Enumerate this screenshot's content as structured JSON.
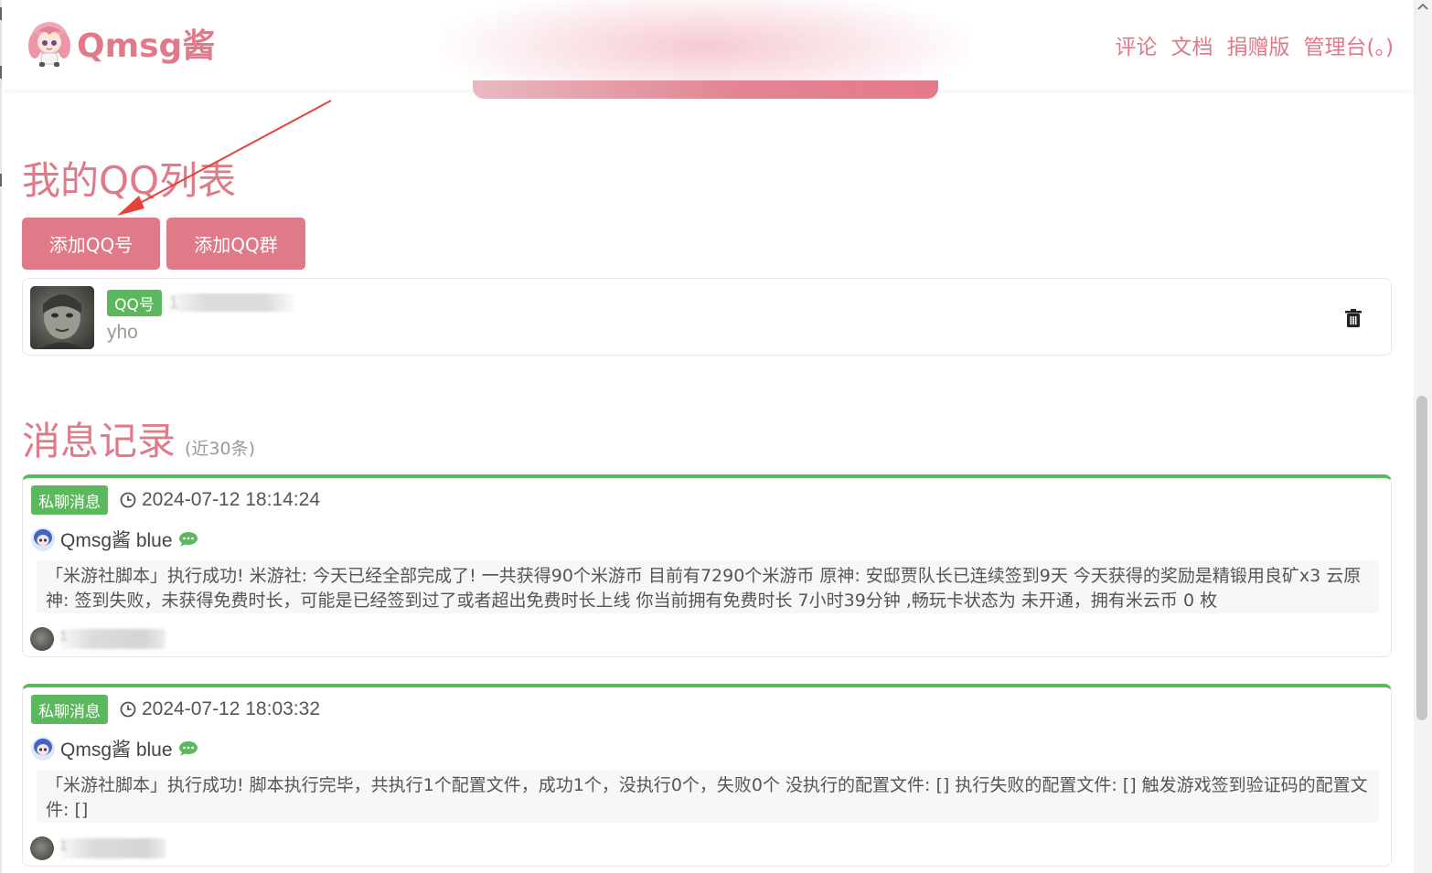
{
  "header": {
    "brand": "Qmsg酱",
    "nav": [
      "评论",
      "文档",
      "捐赠版",
      "管理台(。)"
    ]
  },
  "qq_list": {
    "title": "我的QQ列表",
    "buttons": {
      "add_qq": "添加QQ号",
      "add_group": "添加QQ群"
    },
    "items": [
      {
        "type_tag": "QQ号",
        "number_masked": "1",
        "nickname": "yho"
      }
    ]
  },
  "messages": {
    "title": "消息记录",
    "subtitle": "(近30条)",
    "items": [
      {
        "tag": "私聊消息",
        "time": "2024-07-12 18:14:24",
        "sender": "Qmsg酱 blue",
        "body": "「米游社脚本」执行成功! 米游社: 今天已经全部完成了!   一共获得90个米游币 目前有7290个米游币 原神: 安邸贾队长已连续签到9天 今天获得的奖励是精锻用良矿x3 云原神: 签到失败，未获得免费时长，可能是已经签到过了或者超出免费时长上线 你当前拥有免费时长 7小时39分钟 ,畅玩卡状态为 未开通，拥有米云币 0 枚",
        "recipient_masked": "1"
      },
      {
        "tag": "私聊消息",
        "time": "2024-07-12 18:03:32",
        "sender": "Qmsg酱 blue",
        "body": "「米游社脚本」执行成功! 脚本执行完毕，共执行1个配置文件，成功1个，没执行0个，失败0个 没执行的配置文件: [] 执行失败的配置文件: [] 触发游戏签到验证码的配置文件: []",
        "recipient_masked": "1"
      }
    ]
  },
  "colors": {
    "brand_pink": "#e07a89",
    "success_green": "#5cb85c"
  },
  "icons": [
    "mascot-logo-icon",
    "trash-icon",
    "clock-icon",
    "chat-bubble-icon",
    "arrow-annotation-icon"
  ]
}
